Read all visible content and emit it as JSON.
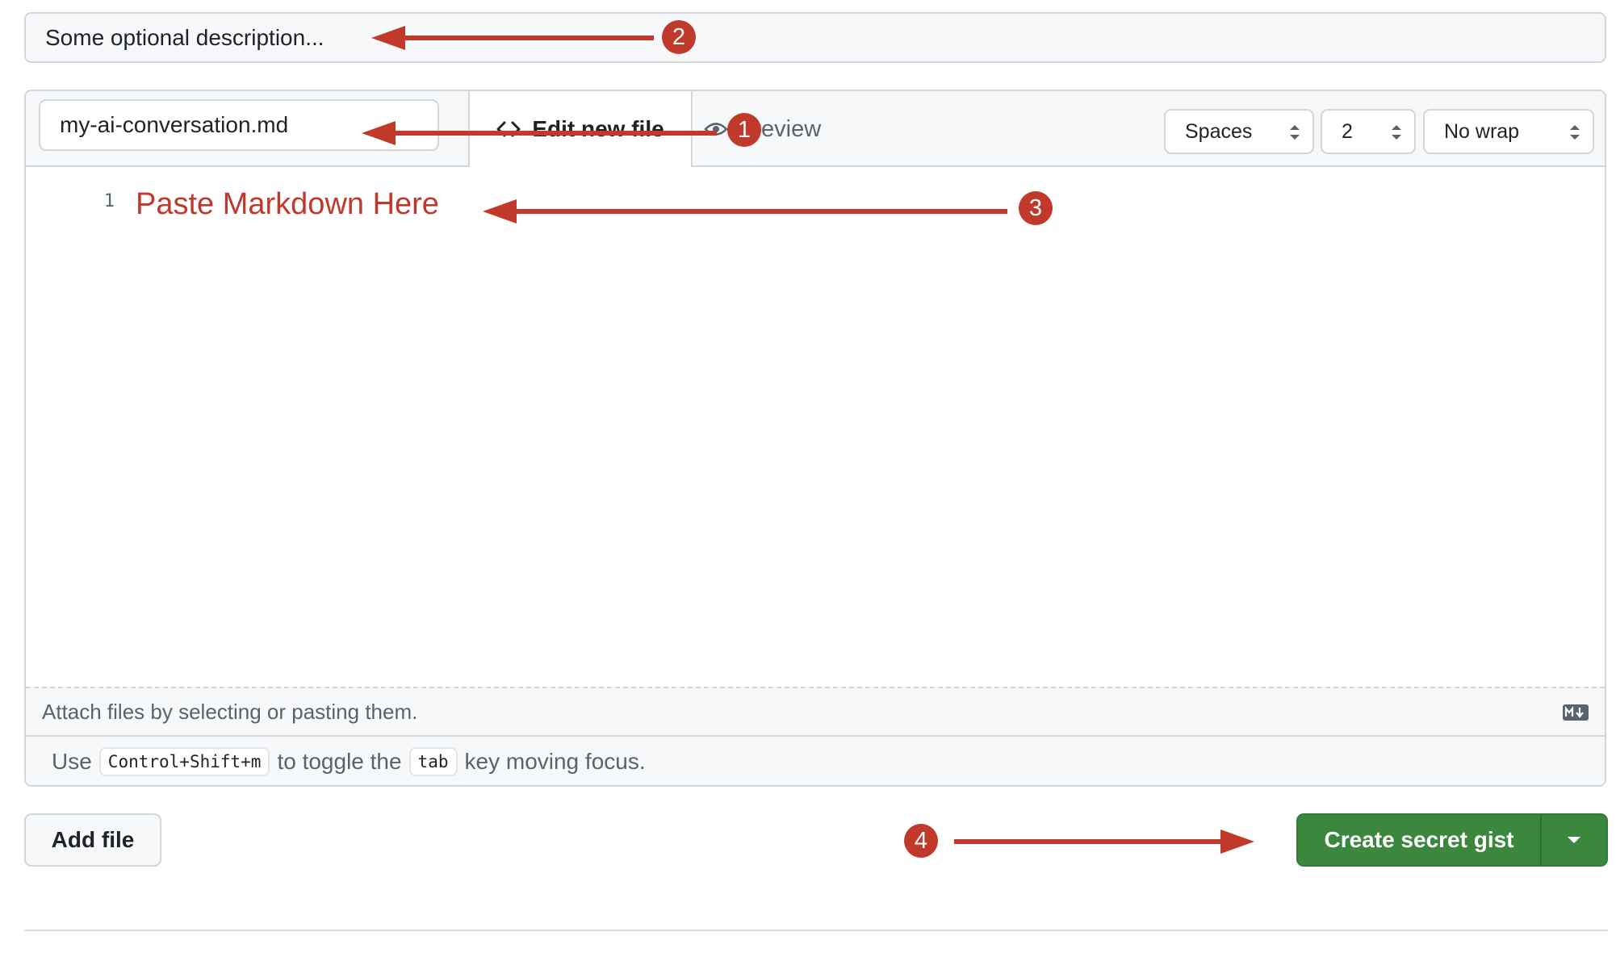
{
  "description": {
    "placeholder": "Some optional description..."
  },
  "file": {
    "name": "my-ai-conversation.md",
    "tabs": [
      {
        "label": "Edit new file"
      },
      {
        "label": "Preview"
      }
    ],
    "indent_mode": "Spaces",
    "indent_size": "2",
    "wrap_mode": "No wrap",
    "line_numbers": [
      "1"
    ],
    "attach_text": "Attach files by selecting or pasting them.",
    "help": {
      "prefix": "Use",
      "shortcut": "Control+Shift+m",
      "middle": "to toggle the",
      "key": "tab",
      "suffix": "key moving focus."
    }
  },
  "actions": {
    "add_file": "Add file",
    "create": "Create secret gist"
  },
  "annotations": {
    "editor_hint": "Paste Markdown Here",
    "badges": [
      "1",
      "2",
      "3",
      "4"
    ],
    "color": "#c0392b"
  },
  "colors": {
    "primary_button": "#3b873e",
    "border": "#d0d7de",
    "muted_bg": "#f6f8fa"
  }
}
